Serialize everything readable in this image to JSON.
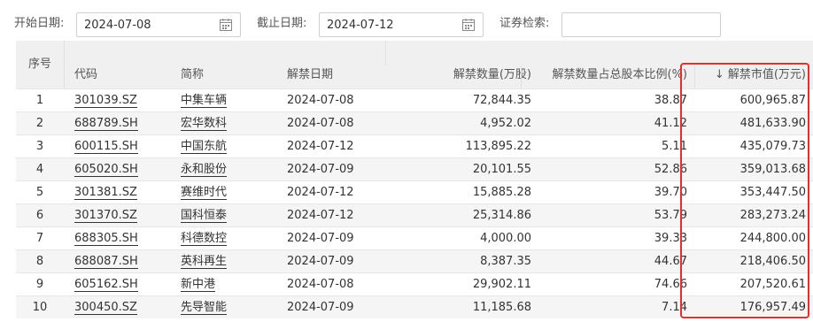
{
  "filters": {
    "start_label": "开始日期:",
    "start_value": "2024-07-08",
    "end_label": "截止日期:",
    "end_value": "2024-07-12",
    "search_label": "证券检索:",
    "search_value": ""
  },
  "table": {
    "columns": {
      "index": "序号",
      "code": "代码",
      "name": "简称",
      "date": "解禁日期",
      "shares": "解禁数量(万股)",
      "ratio": "解禁数量占总股本比例(%)",
      "value": "↓ 解禁市值(万元)"
    },
    "rows": [
      {
        "index": "1",
        "code": "301039.SZ",
        "name": "中集车辆",
        "date": "2024-07-08",
        "shares": "72,844.35",
        "ratio": "38.87",
        "value": "600,965.87"
      },
      {
        "index": "2",
        "code": "688789.SH",
        "name": "宏华数科",
        "date": "2024-07-08",
        "shares": "4,952.02",
        "ratio": "41.12",
        "value": "481,633.90"
      },
      {
        "index": "3",
        "code": "600115.SH",
        "name": "中国东航",
        "date": "2024-07-12",
        "shares": "113,895.22",
        "ratio": "5.11",
        "value": "435,079.73"
      },
      {
        "index": "4",
        "code": "605020.SH",
        "name": "永和股份",
        "date": "2024-07-09",
        "shares": "20,101.55",
        "ratio": "52.86",
        "value": "359,013.68"
      },
      {
        "index": "5",
        "code": "301381.SZ",
        "name": "赛维时代",
        "date": "2024-07-12",
        "shares": "15,885.28",
        "ratio": "39.70",
        "value": "353,447.50"
      },
      {
        "index": "6",
        "code": "301370.SZ",
        "name": "国科恒泰",
        "date": "2024-07-12",
        "shares": "25,314.86",
        "ratio": "53.79",
        "value": "283,273.24"
      },
      {
        "index": "7",
        "code": "688305.SH",
        "name": "科德数控",
        "date": "2024-07-09",
        "shares": "4,000.00",
        "ratio": "39.33",
        "value": "244,800.00"
      },
      {
        "index": "8",
        "code": "688087.SH",
        "name": "英科再生",
        "date": "2024-07-09",
        "shares": "8,387.35",
        "ratio": "44.67",
        "value": "218,406.50"
      },
      {
        "index": "9",
        "code": "605162.SH",
        "name": "新中港",
        "date": "2024-07-08",
        "shares": "29,902.11",
        "ratio": "74.66",
        "value": "207,520.61"
      },
      {
        "index": "10",
        "code": "300450.SZ",
        "name": "先导智能",
        "date": "2024-07-09",
        "shares": "11,185.68",
        "ratio": "7.14",
        "value": "176,957.49"
      }
    ]
  },
  "colors": {
    "highlight": "#e62e2e",
    "header_bg": "#f0f0f0",
    "row_alt_bg": "#f5f5f5"
  }
}
